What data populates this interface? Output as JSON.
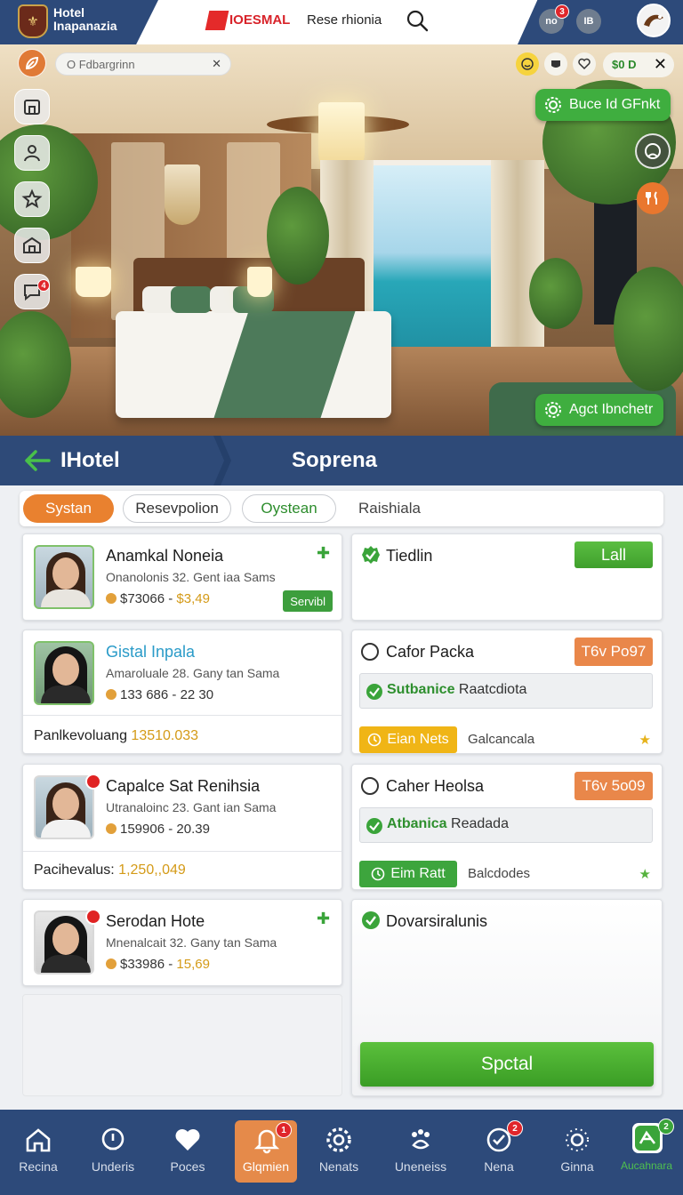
{
  "header": {
    "hotel_name_line1": "Hotel",
    "hotel_name_line2": "Inapanazia",
    "brand_text": "IOESMAL",
    "reserve_link": "Rese rhionia",
    "btn_a": "no",
    "btn_a_badge": "3",
    "btn_b": "IB"
  },
  "hero": {
    "search_placeholder": "O Fdbargrinn",
    "toolbar_pill": "$0 D",
    "chip_top": "Buce Id GFnkt",
    "chip_bottom": "Agct Ibnchetr",
    "side_badge": "4"
  },
  "section": {
    "back_title": "IHotel",
    "title": "Soprena"
  },
  "tabs": [
    "Systan",
    "Resevpolion",
    "Oystean",
    "Raishiala"
  ],
  "guests": [
    {
      "name": "Anamkal Noneia",
      "sub": "Onanolonis 32. Gent iaa Sams",
      "price_a": "$73066",
      "price_b": "$3,49",
      "button": "Servibl"
    },
    {
      "name": "Gistal Inpala",
      "sub": "Amaroluale 28. Gany tan Sama",
      "price_a": "133 686",
      "price_b": "22 30",
      "footer_label": "Panlkevoluang",
      "footer_value": "13510.033"
    },
    {
      "name": "Capalce Sat Renihsia",
      "sub": "Utranaloinc 23. Gant ian Sama",
      "price_a": "159906",
      "price_b": "20.39",
      "footer_label": "Pacihevalus:",
      "footer_value": "1,250,,049"
    },
    {
      "name": "Serodan Hote",
      "sub": "Mnenalcait 32. Gany tan Sama",
      "price_a": "$33986",
      "price_b": "15,69"
    }
  ],
  "right_cards": [
    {
      "title": "Tiedlin",
      "button": "Lall"
    },
    {
      "title": "Cafor Packa",
      "tag": "T6v Po97",
      "status_bold": "Sutbanice",
      "status_rest": "Raatcdiota",
      "chip": "Eian Nets",
      "label": "Galcancala"
    },
    {
      "title": "Caher Heolsa",
      "tag": "T6v 5o09",
      "status_bold": "Atbanica",
      "status_rest": "Readada",
      "chip": "Eim Ratt",
      "label": "Balcdodes"
    },
    {
      "title": "Dovarsiralunis",
      "button": "Spctal"
    }
  ],
  "nav": [
    {
      "label": "Recina"
    },
    {
      "label": "Underis"
    },
    {
      "label": "Poces"
    },
    {
      "label": "Glqmien",
      "badge": "1"
    },
    {
      "label": "Nenats"
    },
    {
      "label": "Uneneiss"
    },
    {
      "label": "Nena",
      "badge": "2"
    },
    {
      "label": "Ginna"
    },
    {
      "label": "Aucahnara",
      "badge": "2"
    }
  ],
  "colors": {
    "navy": "#2d4a7a",
    "accent_orange": "#e9812f",
    "accent_green": "#3fae3f",
    "price_gold": "#d49a17"
  }
}
